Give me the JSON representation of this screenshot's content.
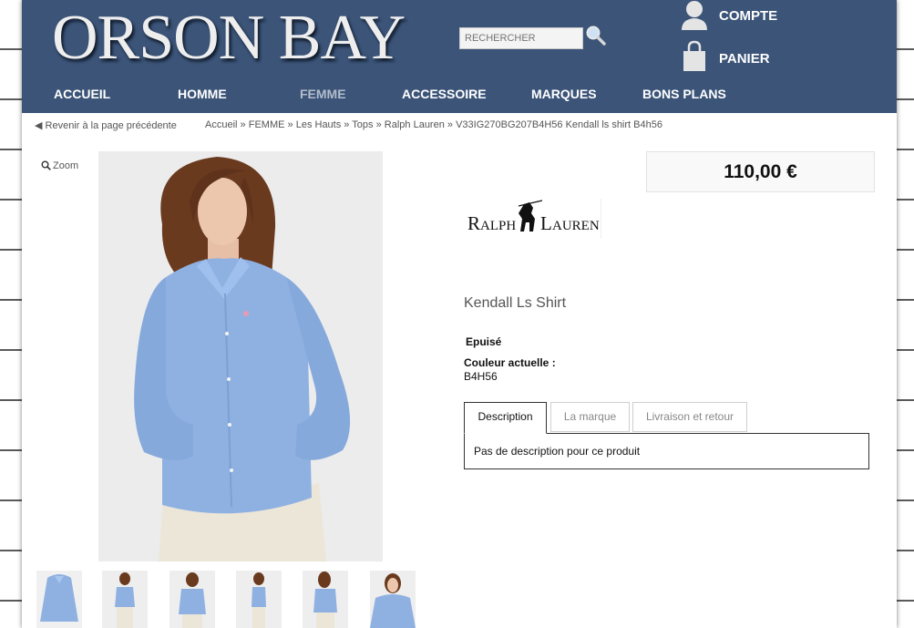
{
  "header": {
    "logo": "ORSON BAY",
    "search_placeholder": "RECHERCHER",
    "account_label": "COMPTE",
    "cart_label": "PANIER"
  },
  "nav": {
    "items": [
      {
        "label": "ACCUEIL"
      },
      {
        "label": "HOMME"
      },
      {
        "label": "FEMME",
        "active": true
      },
      {
        "label": "ACCESSOIRE"
      },
      {
        "label": "MARQUES"
      },
      {
        "label": "BONS PLANS"
      }
    ]
  },
  "back_link": "Revenir à la page précédente",
  "breadcrumb": {
    "items": [
      "Accueil",
      "Les Hauts",
      "Tops",
      "Ralph Lauren"
    ],
    "current": "V33IG270BG207B4H56 Kendall ls shirt B4h56",
    "separator": "»"
  },
  "zoom_label": "Zoom",
  "product": {
    "price": "110,00 €",
    "brand_logo": "RALPH LAUREN",
    "title": "Kendall Ls Shirt",
    "stock": "Epuisé",
    "color_label": "Couleur actuelle :",
    "color_value": "B4H56"
  },
  "tabs": [
    {
      "label": "Description",
      "active": true
    },
    {
      "label": "La marque"
    },
    {
      "label": "Livraison et retour"
    }
  ],
  "tab_content": "Pas de description pour ce produit",
  "colors": {
    "header_bg": "#3b5478",
    "shirt": "#8fb1e2",
    "page_bg": "#ffffff"
  }
}
